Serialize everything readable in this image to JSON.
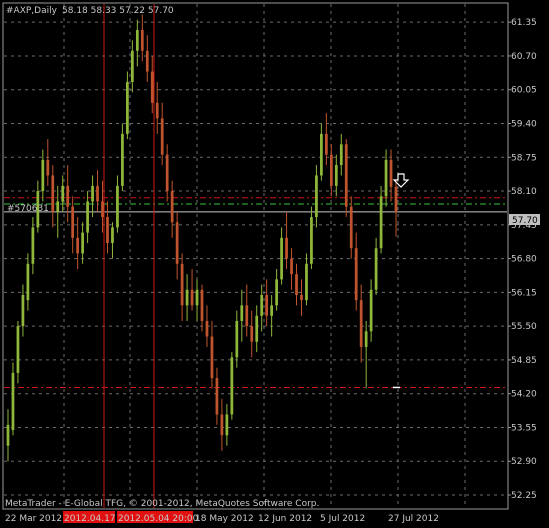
{
  "header": {
    "symbol_label": "#AXP,Daily",
    "ohlc_text": "58.18 58.33 57.22 57.70"
  },
  "footer": {
    "copyright": "MetaTrader - E-Global TFG, © 2001-2012, MetaQuotes Software Corp."
  },
  "price_tag": "57.70",
  "left_line_label": "#570631",
  "x_dates": [
    "22 Mar 2012",
    "2012.04.17",
    "2012.05.04 20:00",
    "18 May 2012",
    "12 Jun 2012",
    "5 Jul 2012",
    "27 Jul 2012"
  ],
  "y_ticks": [
    "61.35",
    "60.70",
    "60.05",
    "59.40",
    "58.75",
    "58.10",
    "57.45",
    "56.80",
    "56.15",
    "55.50",
    "54.85",
    "54.20",
    "53.55",
    "52.90",
    "52.25"
  ],
  "colors": {
    "background": "#000000",
    "grid": "#6b6b6b",
    "frame": "#9a9a9a",
    "bull": "#8fb83a",
    "bear": "#c0542e",
    "wick": "#a0a0a0",
    "red_line": "#d01818",
    "green_line": "#3cbf3c",
    "hline_price": "#c8c8c8",
    "price_tag_bg": "#c0c0c0"
  },
  "chart_data": {
    "type": "candlestick",
    "symbol": "#AXP",
    "timeframe": "Daily",
    "ylim": [
      52.0,
      61.7
    ],
    "lines": {
      "price_line": 57.7,
      "upper_red_dashed": 57.97,
      "green_dashed": 57.85,
      "lower_red_dashed": 54.32
    },
    "ohlc": [
      [
        53.2,
        53.9,
        52.9,
        53.6
      ],
      [
        53.5,
        54.8,
        53.4,
        54.6
      ],
      [
        54.6,
        55.6,
        54.4,
        55.5
      ],
      [
        55.5,
        56.3,
        55.3,
        56.1
      ],
      [
        56.0,
        56.9,
        55.8,
        56.7
      ],
      [
        56.7,
        57.6,
        56.5,
        57.4
      ],
      [
        57.4,
        58.3,
        57.3,
        58.1
      ],
      [
        58.1,
        58.9,
        57.9,
        58.7
      ],
      [
        58.7,
        59.1,
        58.2,
        58.4
      ],
      [
        58.4,
        58.6,
        57.4,
        57.7
      ],
      [
        57.7,
        58.2,
        57.2,
        57.9
      ],
      [
        57.9,
        58.4,
        57.7,
        58.2
      ],
      [
        58.2,
        58.6,
        57.5,
        57.8
      ],
      [
        57.8,
        58.0,
        56.9,
        57.2
      ],
      [
        57.2,
        57.6,
        56.6,
        56.9
      ],
      [
        56.9,
        57.5,
        56.7,
        57.3
      ],
      [
        57.3,
        58.1,
        57.1,
        57.9
      ],
      [
        57.9,
        58.4,
        57.6,
        58.2
      ],
      [
        58.2,
        58.5,
        57.7,
        57.9
      ],
      [
        57.9,
        58.3,
        57.3,
        57.6
      ],
      [
        57.6,
        57.9,
        56.9,
        57.1
      ],
      [
        57.1,
        57.5,
        56.8,
        57.4
      ],
      [
        57.4,
        58.4,
        57.3,
        58.2
      ],
      [
        58.2,
        59.4,
        58.1,
        59.2
      ],
      [
        59.2,
        60.4,
        59.1,
        60.2
      ],
      [
        60.2,
        61.0,
        60.0,
        60.8
      ],
      [
        60.8,
        61.4,
        60.5,
        61.2
      ],
      [
        61.2,
        61.5,
        60.6,
        60.8
      ],
      [
        60.8,
        61.1,
        60.2,
        60.4
      ],
      [
        60.4,
        60.7,
        59.6,
        59.8
      ],
      [
        59.8,
        60.2,
        59.2,
        59.5
      ],
      [
        59.5,
        59.8,
        58.6,
        58.8
      ],
      [
        58.8,
        59.0,
        57.9,
        58.1
      ],
      [
        58.1,
        58.3,
        57.2,
        57.5
      ],
      [
        57.5,
        57.7,
        56.4,
        56.7
      ],
      [
        56.7,
        56.9,
        55.6,
        55.9
      ],
      [
        55.9,
        56.5,
        55.6,
        56.2
      ],
      [
        56.2,
        56.6,
        55.8,
        55.9
      ],
      [
        55.9,
        56.4,
        55.6,
        56.2
      ],
      [
        56.2,
        56.3,
        55.4,
        55.6
      ],
      [
        55.6,
        55.9,
        55.1,
        55.3
      ],
      [
        55.3,
        55.6,
        54.3,
        54.5
      ],
      [
        54.5,
        54.7,
        53.6,
        53.8
      ],
      [
        53.8,
        54.1,
        53.1,
        53.4
      ],
      [
        53.4,
        54.0,
        53.2,
        53.8
      ],
      [
        53.8,
        55.0,
        53.7,
        54.9
      ],
      [
        54.9,
        55.8,
        54.7,
        55.6
      ],
      [
        55.6,
        56.2,
        55.2,
        55.9
      ],
      [
        55.9,
        56.3,
        55.3,
        55.5
      ],
      [
        55.5,
        55.8,
        54.9,
        55.2
      ],
      [
        55.2,
        55.9,
        55.0,
        55.7
      ],
      [
        55.7,
        56.3,
        55.4,
        56.1
      ],
      [
        56.1,
        56.4,
        55.5,
        55.7
      ],
      [
        55.7,
        56.1,
        55.3,
        55.9
      ],
      [
        55.9,
        56.6,
        55.8,
        56.4
      ],
      [
        56.4,
        57.4,
        56.3,
        57.2
      ],
      [
        57.2,
        57.7,
        56.6,
        56.8
      ],
      [
        56.8,
        57.0,
        56.2,
        56.5
      ],
      [
        56.5,
        56.7,
        55.9,
        56.1
      ],
      [
        56.1,
        56.4,
        55.7,
        56.0
      ],
      [
        56.0,
        56.9,
        55.9,
        56.7
      ],
      [
        56.7,
        57.8,
        56.6,
        57.6
      ],
      [
        57.6,
        58.6,
        57.4,
        58.4
      ],
      [
        58.4,
        59.4,
        58.3,
        59.2
      ],
      [
        59.2,
        59.6,
        58.6,
        58.8
      ],
      [
        58.8,
        59.0,
        58.0,
        58.2
      ],
      [
        58.2,
        58.8,
        58.0,
        58.6
      ],
      [
        58.6,
        59.2,
        58.4,
        59.0
      ],
      [
        59.0,
        59.1,
        57.6,
        57.8
      ],
      [
        57.8,
        58.0,
        56.8,
        57.0
      ],
      [
        57.0,
        57.3,
        55.8,
        56.0
      ],
      [
        56.0,
        56.3,
        54.8,
        55.1
      ],
      [
        55.1,
        55.6,
        54.3,
        55.4
      ],
      [
        55.4,
        56.4,
        55.2,
        56.2
      ],
      [
        56.2,
        57.2,
        56.1,
        57.0
      ],
      [
        57.0,
        58.2,
        56.9,
        58.0
      ],
      [
        58.0,
        58.9,
        57.8,
        58.7
      ],
      [
        58.7,
        58.9,
        57.9,
        58.18
      ],
      [
        58.18,
        58.33,
        57.22,
        57.7
      ]
    ]
  }
}
